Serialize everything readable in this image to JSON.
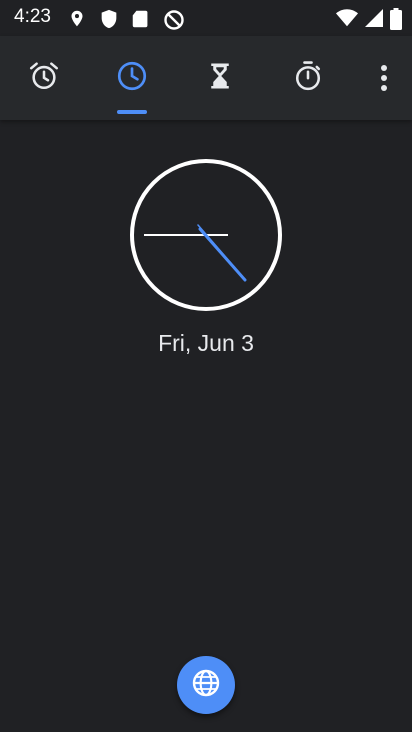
{
  "status_bar": {
    "time": "4:23",
    "left_icons": [
      "maps-icon",
      "shield-icon",
      "sd-card-icon",
      "do-not-disturb-icon"
    ],
    "right_icons": [
      "wifi-icon",
      "signal-icon",
      "battery-icon"
    ]
  },
  "tabs": [
    {
      "icon": "alarm-icon",
      "selected": false
    },
    {
      "icon": "clock-icon",
      "selected": true
    },
    {
      "icon": "timer-icon",
      "selected": false
    },
    {
      "icon": "stopwatch-icon",
      "selected": false
    }
  ],
  "overflow_menu": {
    "icon": "more-vert-icon"
  },
  "clock": {
    "date": "Fri, Jun 3"
  },
  "fab": {
    "icon": "globe-icon"
  },
  "colors": {
    "background": "#202124",
    "toolbar": "#27292c",
    "accent": "#4e8ef7",
    "icon": "#e8eaed"
  }
}
